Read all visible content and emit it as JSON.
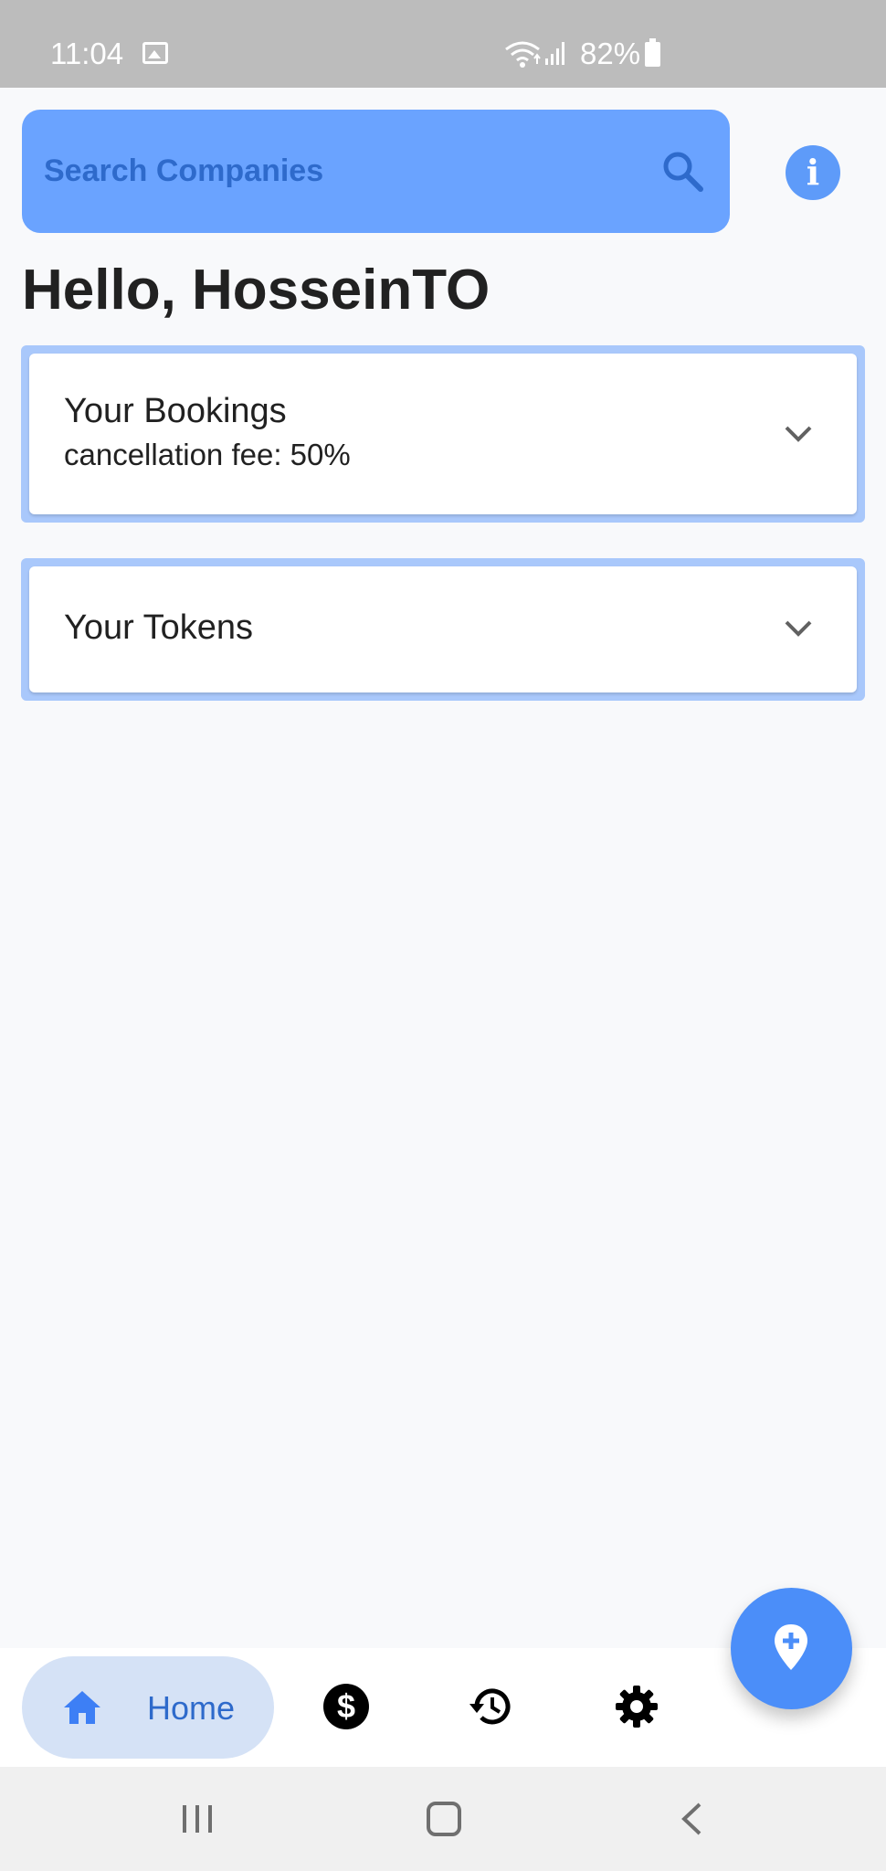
{
  "status_bar": {
    "time": "11:04",
    "battery": "82%",
    "icons": [
      "gallery-icon",
      "wifi-icon",
      "signal-icon",
      "battery-icon"
    ]
  },
  "search": {
    "placeholder": "Search Companies",
    "icon": "search-icon"
  },
  "info_icon": "info-icon",
  "greeting": "Hello, HosseinTO",
  "cards": {
    "bookings": {
      "title": "Your Bookings",
      "subtitle": "cancellation fee: 50%"
    },
    "tokens": {
      "title": "Your Tokens"
    }
  },
  "bottom_nav": {
    "home_label": "Home",
    "items": [
      "home-icon",
      "dollar-icon",
      "history-icon",
      "settings-icon"
    ],
    "dollar_glyph": "$"
  },
  "fab": {
    "icon": "add-location-icon"
  },
  "system_nav": [
    "recent-apps-icon",
    "home-icon",
    "back-icon"
  ],
  "colors": {
    "accent": "#4b8ef9",
    "search_bg": "#6aa3ff",
    "search_text": "#2e6acb",
    "card_border": "#a9c8fb",
    "nav_selected_bg": "#d5e2f6",
    "status_bar": "#bcbcbc"
  }
}
